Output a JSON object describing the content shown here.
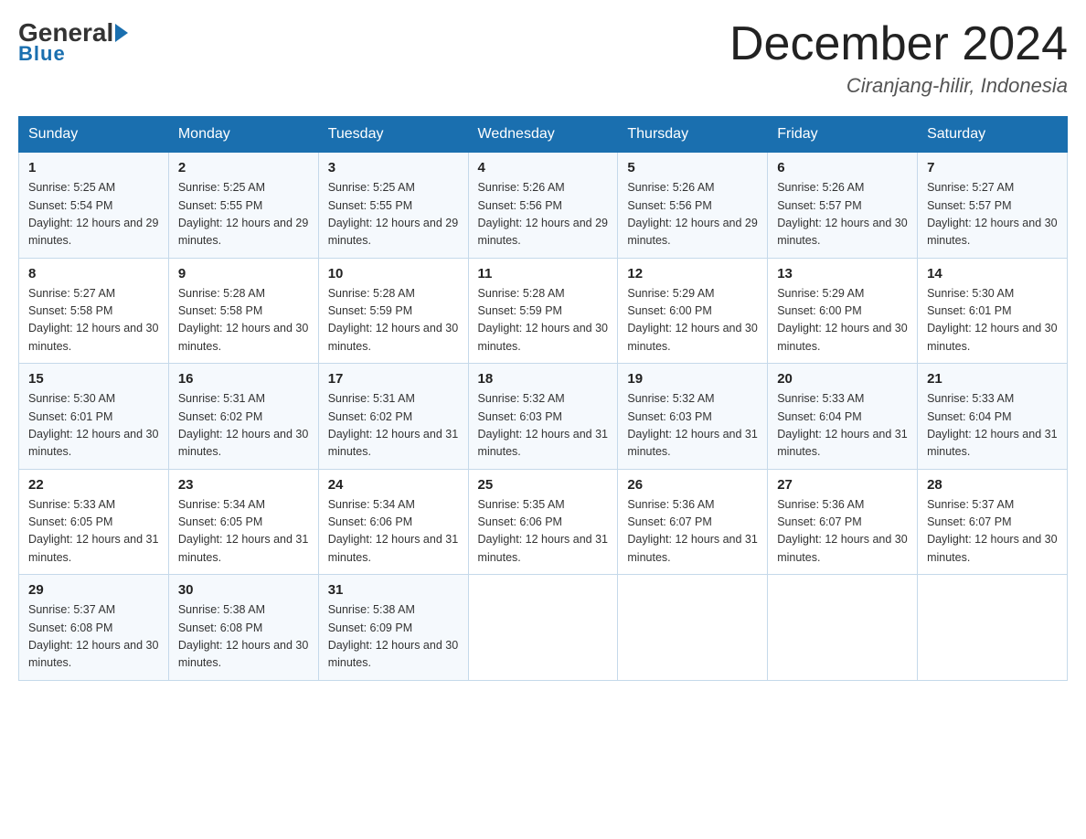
{
  "header": {
    "logo_general": "General",
    "logo_blue": "Blue",
    "month_title": "December 2024",
    "location": "Ciranjang-hilir, Indonesia"
  },
  "days_of_week": [
    "Sunday",
    "Monday",
    "Tuesday",
    "Wednesday",
    "Thursday",
    "Friday",
    "Saturday"
  ],
  "weeks": [
    [
      {
        "day": "1",
        "sunrise": "5:25 AM",
        "sunset": "5:54 PM",
        "daylight": "12 hours and 29 minutes."
      },
      {
        "day": "2",
        "sunrise": "5:25 AM",
        "sunset": "5:55 PM",
        "daylight": "12 hours and 29 minutes."
      },
      {
        "day": "3",
        "sunrise": "5:25 AM",
        "sunset": "5:55 PM",
        "daylight": "12 hours and 29 minutes."
      },
      {
        "day": "4",
        "sunrise": "5:26 AM",
        "sunset": "5:56 PM",
        "daylight": "12 hours and 29 minutes."
      },
      {
        "day": "5",
        "sunrise": "5:26 AM",
        "sunset": "5:56 PM",
        "daylight": "12 hours and 29 minutes."
      },
      {
        "day": "6",
        "sunrise": "5:26 AM",
        "sunset": "5:57 PM",
        "daylight": "12 hours and 30 minutes."
      },
      {
        "day": "7",
        "sunrise": "5:27 AM",
        "sunset": "5:57 PM",
        "daylight": "12 hours and 30 minutes."
      }
    ],
    [
      {
        "day": "8",
        "sunrise": "5:27 AM",
        "sunset": "5:58 PM",
        "daylight": "12 hours and 30 minutes."
      },
      {
        "day": "9",
        "sunrise": "5:28 AM",
        "sunset": "5:58 PM",
        "daylight": "12 hours and 30 minutes."
      },
      {
        "day": "10",
        "sunrise": "5:28 AM",
        "sunset": "5:59 PM",
        "daylight": "12 hours and 30 minutes."
      },
      {
        "day": "11",
        "sunrise": "5:28 AM",
        "sunset": "5:59 PM",
        "daylight": "12 hours and 30 minutes."
      },
      {
        "day": "12",
        "sunrise": "5:29 AM",
        "sunset": "6:00 PM",
        "daylight": "12 hours and 30 minutes."
      },
      {
        "day": "13",
        "sunrise": "5:29 AM",
        "sunset": "6:00 PM",
        "daylight": "12 hours and 30 minutes."
      },
      {
        "day": "14",
        "sunrise": "5:30 AM",
        "sunset": "6:01 PM",
        "daylight": "12 hours and 30 minutes."
      }
    ],
    [
      {
        "day": "15",
        "sunrise": "5:30 AM",
        "sunset": "6:01 PM",
        "daylight": "12 hours and 30 minutes."
      },
      {
        "day": "16",
        "sunrise": "5:31 AM",
        "sunset": "6:02 PM",
        "daylight": "12 hours and 30 minutes."
      },
      {
        "day": "17",
        "sunrise": "5:31 AM",
        "sunset": "6:02 PM",
        "daylight": "12 hours and 31 minutes."
      },
      {
        "day": "18",
        "sunrise": "5:32 AM",
        "sunset": "6:03 PM",
        "daylight": "12 hours and 31 minutes."
      },
      {
        "day": "19",
        "sunrise": "5:32 AM",
        "sunset": "6:03 PM",
        "daylight": "12 hours and 31 minutes."
      },
      {
        "day": "20",
        "sunrise": "5:33 AM",
        "sunset": "6:04 PM",
        "daylight": "12 hours and 31 minutes."
      },
      {
        "day": "21",
        "sunrise": "5:33 AM",
        "sunset": "6:04 PM",
        "daylight": "12 hours and 31 minutes."
      }
    ],
    [
      {
        "day": "22",
        "sunrise": "5:33 AM",
        "sunset": "6:05 PM",
        "daylight": "12 hours and 31 minutes."
      },
      {
        "day": "23",
        "sunrise": "5:34 AM",
        "sunset": "6:05 PM",
        "daylight": "12 hours and 31 minutes."
      },
      {
        "day": "24",
        "sunrise": "5:34 AM",
        "sunset": "6:06 PM",
        "daylight": "12 hours and 31 minutes."
      },
      {
        "day": "25",
        "sunrise": "5:35 AM",
        "sunset": "6:06 PM",
        "daylight": "12 hours and 31 minutes."
      },
      {
        "day": "26",
        "sunrise": "5:36 AM",
        "sunset": "6:07 PM",
        "daylight": "12 hours and 31 minutes."
      },
      {
        "day": "27",
        "sunrise": "5:36 AM",
        "sunset": "6:07 PM",
        "daylight": "12 hours and 30 minutes."
      },
      {
        "day": "28",
        "sunrise": "5:37 AM",
        "sunset": "6:07 PM",
        "daylight": "12 hours and 30 minutes."
      }
    ],
    [
      {
        "day": "29",
        "sunrise": "5:37 AM",
        "sunset": "6:08 PM",
        "daylight": "12 hours and 30 minutes."
      },
      {
        "day": "30",
        "sunrise": "5:38 AM",
        "sunset": "6:08 PM",
        "daylight": "12 hours and 30 minutes."
      },
      {
        "day": "31",
        "sunrise": "5:38 AM",
        "sunset": "6:09 PM",
        "daylight": "12 hours and 30 minutes."
      },
      null,
      null,
      null,
      null
    ]
  ]
}
